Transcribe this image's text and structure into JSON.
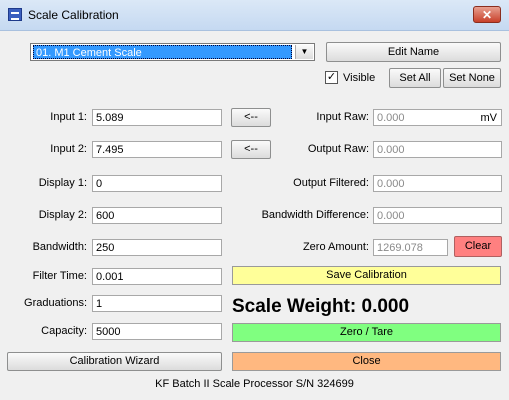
{
  "window": {
    "title": "Scale Calibration",
    "close_glyph": "✕",
    "icon": "scale-app-icon"
  },
  "scale_select": {
    "value": "01. M1 Cement Scale",
    "arrow": "▼"
  },
  "buttons": {
    "edit_name": "Edit Name",
    "set_all": "Set All",
    "set_none": "Set None",
    "copy_input1": "<--",
    "copy_input2": "<--",
    "clear": "Clear",
    "save_calibration": "Save Calibration",
    "zero_tare": "Zero / Tare",
    "calibration_wizard": "Calibration Wizard",
    "close": "Close"
  },
  "visible": {
    "label": "Visible",
    "checked": true,
    "check_glyph": "✓"
  },
  "fields": {
    "input1": {
      "label": "Input 1:",
      "value": "5.089"
    },
    "input2": {
      "label": "Input 2:",
      "value": "7.495"
    },
    "display1": {
      "label": "Display 1:",
      "value": "0"
    },
    "display2": {
      "label": "Display 2:",
      "value": "600"
    },
    "bandwidth": {
      "label": "Bandwidth:",
      "value": "250"
    },
    "filter_time": {
      "label": "Filter Time:",
      "value": "0.001"
    },
    "graduations": {
      "label": "Graduations:",
      "value": "1"
    },
    "capacity": {
      "label": "Capacity:",
      "value": "5000"
    }
  },
  "readouts": {
    "input_raw": {
      "label": "Input Raw:",
      "value": "0.000",
      "unit": "mV"
    },
    "output_raw": {
      "label": "Output Raw:",
      "value": "0.000"
    },
    "output_filtered": {
      "label": "Output Filtered:",
      "value": "0.000"
    },
    "bandwidth_difference": {
      "label": "Bandwidth Difference:",
      "value": "0.000"
    },
    "zero_amount": {
      "label": "Zero Amount:",
      "value": "1269.078"
    }
  },
  "scale_weight": "Scale Weight: 0.000",
  "footer": "KF Batch II Scale Processor S/N 324699",
  "colors": {
    "save": "#ffff99",
    "zero": "#80ff80",
    "close": "#ffb880",
    "clear": "#ff8080",
    "selection": "#3399ff"
  }
}
